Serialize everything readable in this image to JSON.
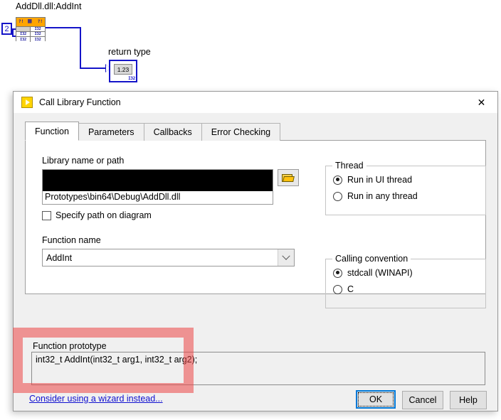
{
  "diagram": {
    "node_label": "AddDll.dll:AddInt",
    "constant_value": "2",
    "indicator_label": "return type",
    "indicator_value": "1.23",
    "indicator_type": "I32",
    "terminal_type": "I32",
    "header_glyph_left": "?!",
    "header_glyph_right": "?!"
  },
  "dialog": {
    "title": "Call Library Function",
    "close_label": "✕",
    "tabs": [
      {
        "label": "Function",
        "active": true
      },
      {
        "label": "Parameters",
        "active": false
      },
      {
        "label": "Callbacks",
        "active": false
      },
      {
        "label": "Error Checking",
        "active": false
      }
    ],
    "library": {
      "label": "Library name or path",
      "value_line1": "",
      "value_line2": "Prototypes\\bin64\\Debug\\AddDll.dll",
      "browse_icon": "folder-open-icon"
    },
    "specify_path": {
      "label": "Specify path on diagram",
      "checked": false
    },
    "function_name": {
      "label": "Function name",
      "value": "AddInt",
      "dropdown_icon": "chevron-down-icon"
    },
    "thread": {
      "title": "Thread",
      "options": [
        {
          "label": "Run in UI thread",
          "selected": true
        },
        {
          "label": "Run in any thread",
          "selected": false
        }
      ]
    },
    "calling_convention": {
      "title": "Calling convention",
      "options": [
        {
          "label": "stdcall (WINAPI)",
          "selected": true
        },
        {
          "label": "C",
          "selected": false
        }
      ]
    },
    "prototype": {
      "label": "Function prototype",
      "value": "int32_t AddInt(int32_t arg1, int32_t arg2);"
    },
    "wizard_link": "Consider using a wizard instead...",
    "buttons": {
      "ok": "OK",
      "cancel": "Cancel",
      "help": "Help"
    }
  },
  "annotation": {
    "highlight_color": "#ed4646",
    "target": "function-prototype-group"
  },
  "colors": {
    "accent_blue": "#0078d7",
    "wire_blue": "#1414c8",
    "node_orange": "#ffa500",
    "link_blue": "#1010d0"
  }
}
